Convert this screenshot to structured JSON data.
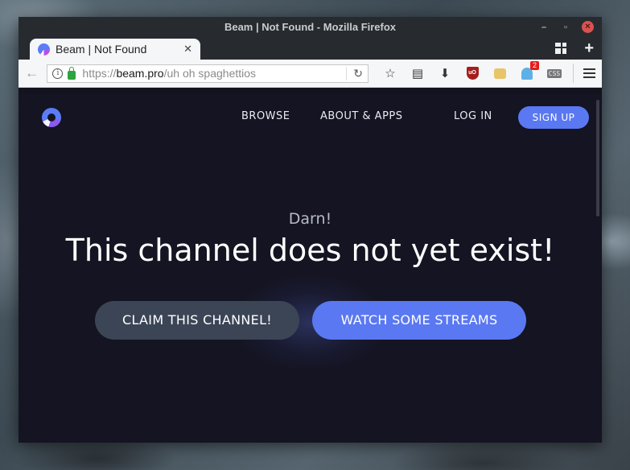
{
  "window": {
    "title": "Beam | Not Found - Mozilla Firefox",
    "controls": {
      "minimize": "–",
      "maximize": "▫",
      "close": "✕"
    }
  },
  "tab": {
    "title": "Beam | Not Found",
    "close": "✕"
  },
  "tabstrip": {
    "new_tab": "+"
  },
  "urlbar": {
    "protocol": "https://",
    "host": "beam.pro",
    "path": "/uh oh spaghettios",
    "reload": "↻"
  },
  "toolbar": {
    "back": "←",
    "bookmark_star": "☆",
    "reader": "▤",
    "download": "⬇",
    "ublock": "uO",
    "notification_badge": "2",
    "css_label": "CSS"
  },
  "site": {
    "nav": {
      "browse": "BROWSE",
      "about": "ABOUT & APPS",
      "login": "LOG IN",
      "signup": "SIGN UP"
    },
    "sub_heading": "Darn!",
    "heading": "This channel does not yet exist!",
    "claim_button": "CLAIM THIS CHANNEL!",
    "watch_button": "WATCH SOME STREAMS",
    "colors": {
      "accent": "#5a78f2",
      "background": "#141422",
      "secondary_button": "#3c4556"
    }
  }
}
